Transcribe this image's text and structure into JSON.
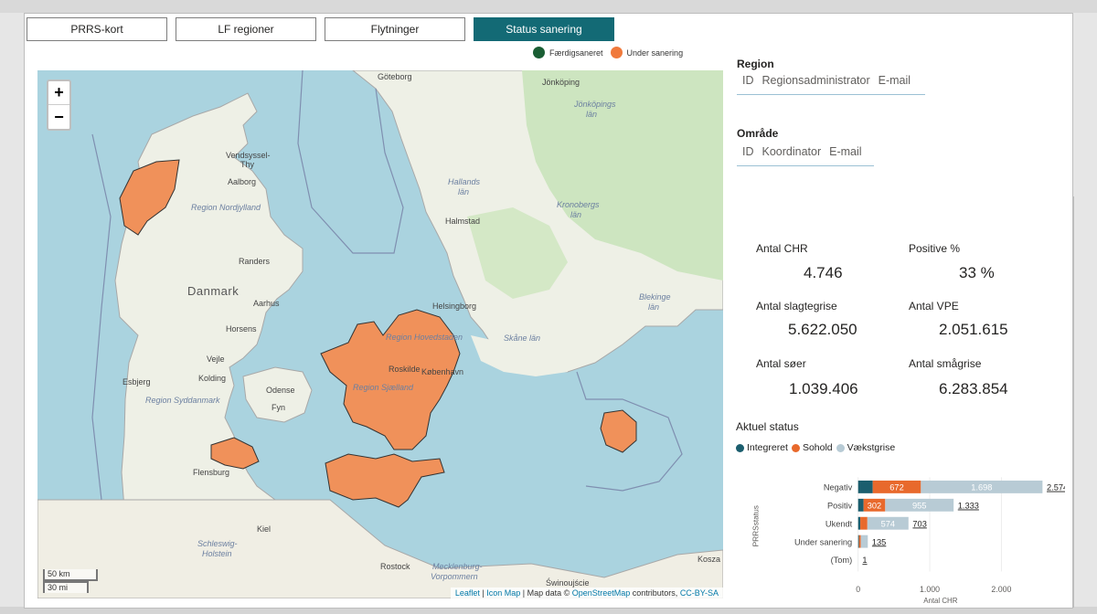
{
  "tabs": [
    {
      "label": "PRRS-kort",
      "active": false
    },
    {
      "label": "LF regioner",
      "active": false
    },
    {
      "label": "Flytninger",
      "active": false
    },
    {
      "label": "Status sanering",
      "active": true
    }
  ],
  "map_legend": {
    "done": {
      "label": "Færdigsaneret",
      "color": "#1a5e34"
    },
    "ongoing": {
      "label": "Under sanering",
      "color": "#f07a3c"
    }
  },
  "map": {
    "zoom_in": "+",
    "zoom_out": "−",
    "scale_km": "50 km",
    "scale_mi": "30 mi",
    "attribution": {
      "leaflet": "Leaflet",
      "sep1": " | ",
      "iconmap": "Icon Map",
      "sep2": " | Map data © ",
      "osm": "OpenStreetMap",
      "contrib": " contributors, ",
      "license": "CC-BY-SA"
    },
    "labels": {
      "goteborg": "Göteborg",
      "jonkoping": "Jönköping",
      "jonkopings_lan": "Jönköpings",
      "jonkopings_lan2": "län",
      "vendsyssel": "Vendsyssel-",
      "thy": "Thy",
      "aalborg": "Aalborg",
      "region_nordjylland": "Region Nordjylland",
      "hallands_lan": "Hallands",
      "hallands_lan2": "län",
      "kronobergs_lan": "Kronobergs",
      "kronobergs_lan2": "län",
      "halmstad": "Halmstad",
      "randers": "Randers",
      "danmark": "Danmark",
      "aarhus": "Aarhus",
      "helsingborg": "Helsingborg",
      "blekinge": "Blekinge",
      "blekinge2": "län",
      "horsens": "Horsens",
      "region_hovedstaden": "Region Hovedstaden",
      "skane_lan": "Skåne län",
      "vejle": "Vejle",
      "esbjerg": "Esbjerg",
      "kolding": "Kolding",
      "roskilde": "Roskilde",
      "kobenhavn": "København",
      "region_syddanmark": "Region Syddanmark",
      "odense": "Odense",
      "region_sjaelland": "Region Sjælland",
      "fyn": "Fyn",
      "flensburg": "Flensburg",
      "kiel": "Kiel",
      "schleswig": "Schleswig-",
      "holstein": "Holstein",
      "rostock": "Rostock",
      "mecklenburg": "Mecklenburg-",
      "vorpommern": "Vorpommern",
      "koszalin": "Kosza",
      "swinoujscie": "Świnoujście"
    }
  },
  "region": {
    "title": "Region",
    "cols": [
      "ID",
      "Regionsadministrator",
      "E-mail"
    ]
  },
  "omraade": {
    "title": "Område",
    "cols": [
      "ID",
      "Koordinator",
      "E-mail"
    ]
  },
  "kpis": {
    "antal_chr": {
      "label": "Antal CHR",
      "value": "4.746"
    },
    "positive_pct": {
      "label": "Positive %",
      "value": "33 %"
    },
    "slagtegrise": {
      "label": "Antal slagtegrise",
      "value": "5.622.050"
    },
    "vpe": {
      "label": "Antal VPE",
      "value": "2.051.615"
    },
    "soer": {
      "label": "Antal søer",
      "value": "1.039.406"
    },
    "smaagrise": {
      "label": "Antal smågrise",
      "value": "6.283.854"
    }
  },
  "status": {
    "title": "Aktuel status",
    "legend": [
      {
        "label": "Integreret",
        "color": "#1b5e6e"
      },
      {
        "label": "Sohold",
        "color": "#e8692c"
      },
      {
        "label": "Vækstgrise",
        "color": "#b8cbd5"
      }
    ]
  },
  "chart_data": {
    "type": "bar",
    "orientation": "horizontal",
    "stacked": true,
    "ylabel": "PRRSstatus",
    "xlabel": "Antal CHR",
    "categories": [
      "Negativ",
      "Positiv",
      "Ukendt",
      "Under sanering",
      "(Tom)"
    ],
    "series": [
      {
        "name": "Integreret",
        "color": "#1b5e6e",
        "values": [
          204,
          76,
          30,
          12,
          0
        ]
      },
      {
        "name": "Sohold",
        "color": "#e8692c",
        "values": [
          672,
          302,
          99,
          25,
          0
        ]
      },
      {
        "name": "Vækstgrise",
        "color": "#b8cbd5",
        "values": [
          1698,
          955,
          574,
          98,
          1
        ]
      }
    ],
    "segment_labels": [
      [
        "",
        "672",
        "1.698"
      ],
      [
        "",
        "302",
        "955"
      ],
      [
        "",
        "",
        "574"
      ],
      [
        "",
        "",
        ""
      ],
      [
        "",
        "",
        ""
      ]
    ],
    "totals": [
      "2.574",
      "1.333",
      "703",
      "135",
      "1"
    ],
    "xticks": [
      "0",
      "1.000",
      "2.000"
    ],
    "xtick_values": [
      0,
      1000,
      2000
    ],
    "xlim": [
      0,
      2600
    ]
  }
}
